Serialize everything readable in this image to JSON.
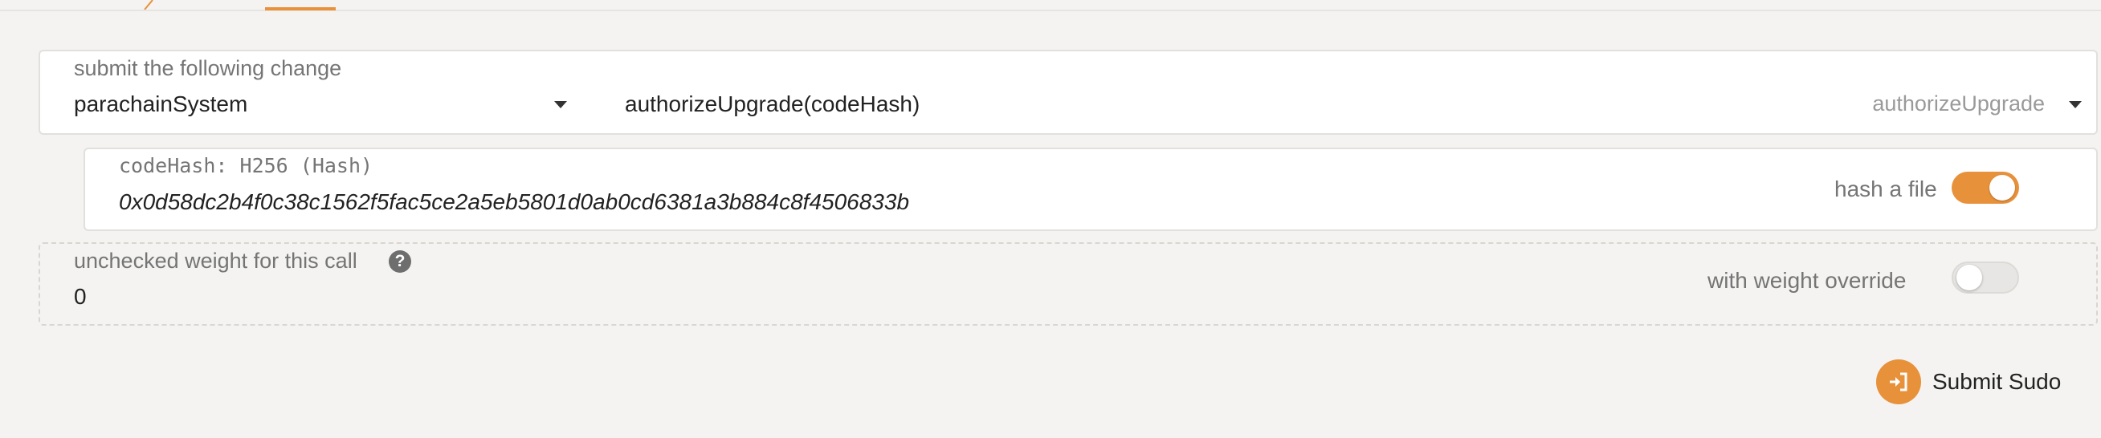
{
  "extrinsic": {
    "label": "submit the following change",
    "section": "parachainSystem",
    "method_signature": "authorizeUpgrade(codeHash)",
    "method_name": "authorizeUpgrade"
  },
  "param": {
    "label": "codeHash: H256 (Hash)",
    "value": "0x0d58dc2b4f0c38c1562f5fac5ce2a5eb5801d0ab0cd6381a3b884c8f4506833b",
    "toggle_label": "hash a file",
    "toggle_on": true
  },
  "weight": {
    "label": "unchecked weight for this call",
    "help_glyph": "?",
    "value": "0",
    "toggle_label": "with weight override",
    "toggle_on": false
  },
  "submit": {
    "label": "Submit Sudo",
    "icon": "sign-in-icon"
  },
  "colors": {
    "accent": "#e8913b",
    "background": "#f4f3f1"
  }
}
